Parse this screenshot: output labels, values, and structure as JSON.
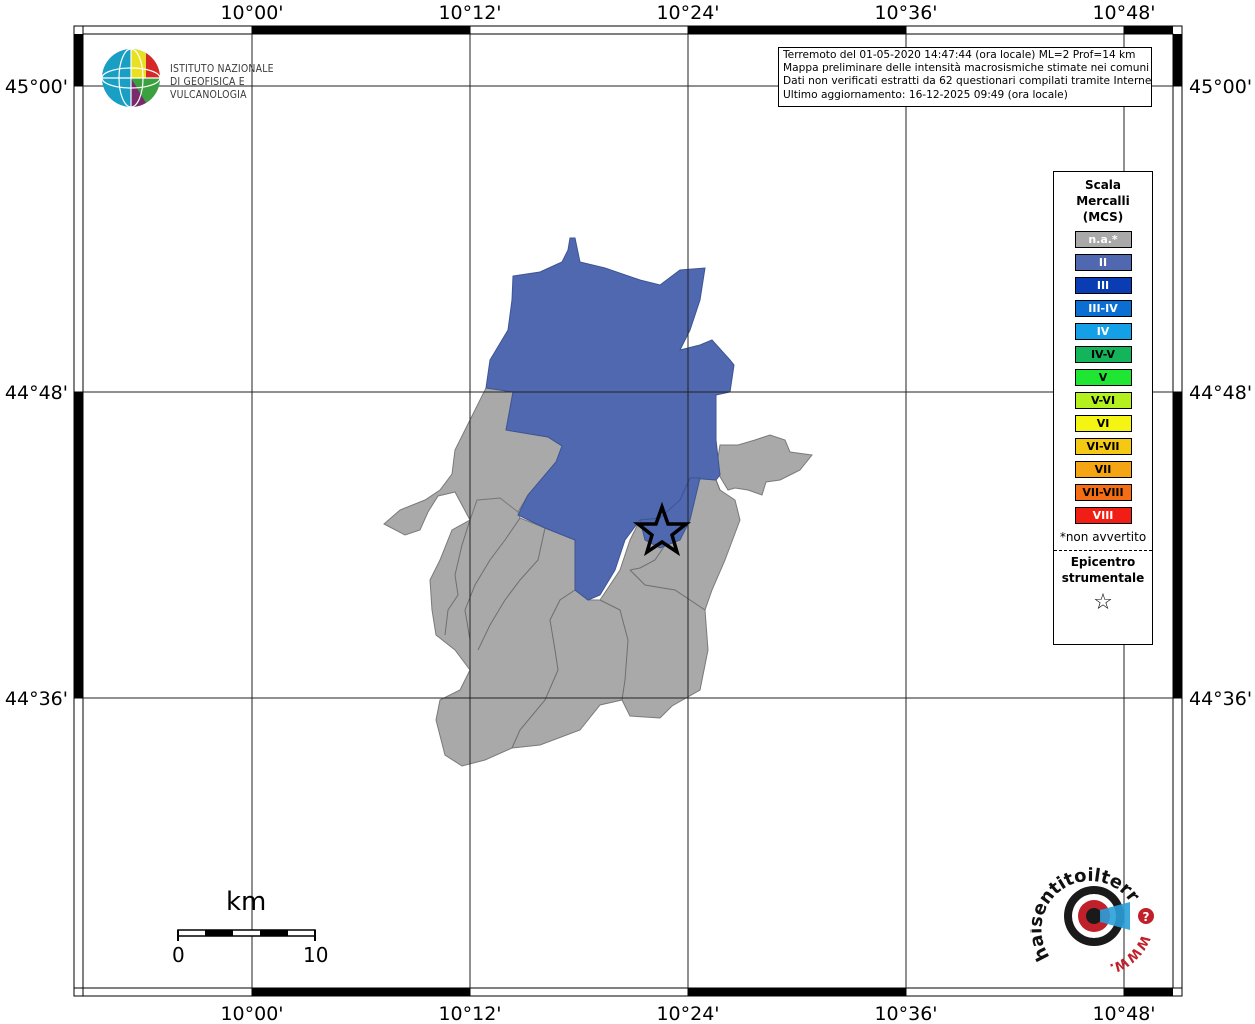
{
  "map": {
    "lon_ticks": [
      "10°00'",
      "10°12'",
      "10°24'",
      "10°36'",
      "10°48'"
    ],
    "lat_ticks": [
      "45°00'",
      "44°48'",
      "44°36'"
    ]
  },
  "logo": {
    "line1": "ISTITUTO NAZIONALE",
    "line2": "DI GEOFISICA E VULCANOLOGIA"
  },
  "info": {
    "line1": "Terremoto del 01-05-2020 14:47:44 (ora locale) ML=2 Prof=14 km",
    "line2": "Mappa preliminare delle intensità macrosismiche stimate nei comuni",
    "line3": "Dati non verificati estratti da 62 questionari compilati tramite Internet.",
    "line4": "Ultimo aggiornamento: 16-12-2025 09:49 (ora locale)"
  },
  "legend": {
    "title1": "Scala",
    "title2": "Mercalli",
    "title3": "(MCS)",
    "items": [
      {
        "label": "n.a.*",
        "color": "#a9a9a9"
      },
      {
        "label": "II",
        "color": "#5068af"
      },
      {
        "label": "III",
        "color": "#0a3cb4"
      },
      {
        "label": "III-IV",
        "color": "#0a6ed2"
      },
      {
        "label": "IV",
        "color": "#14a0e6"
      },
      {
        "label": "IV-V",
        "color": "#14b45a"
      },
      {
        "label": "V",
        "color": "#1ee632"
      },
      {
        "label": "V-VI",
        "color": "#b4f01e"
      },
      {
        "label": "VI",
        "color": "#f5f514"
      },
      {
        "label": "VI-VII",
        "color": "#f5c814"
      },
      {
        "label": "VII",
        "color": "#f5a514"
      },
      {
        "label": "VII-VIII",
        "color": "#f56e14"
      },
      {
        "label": "VIII",
        "color": "#f01e14"
      }
    ],
    "na_note": "*non avvertito",
    "epi1": "Epicentro",
    "epi2": "strumentale",
    "star": "☆"
  },
  "scale": {
    "unit": "km",
    "left": "0",
    "right": "10"
  },
  "haisentito": {
    "text": "haisentitoilterremoto.it",
    "www": "WWW.",
    "q": "?"
  },
  "colors": {
    "intensity_II": "#5068af",
    "not_felt": "#a9a9a9"
  }
}
